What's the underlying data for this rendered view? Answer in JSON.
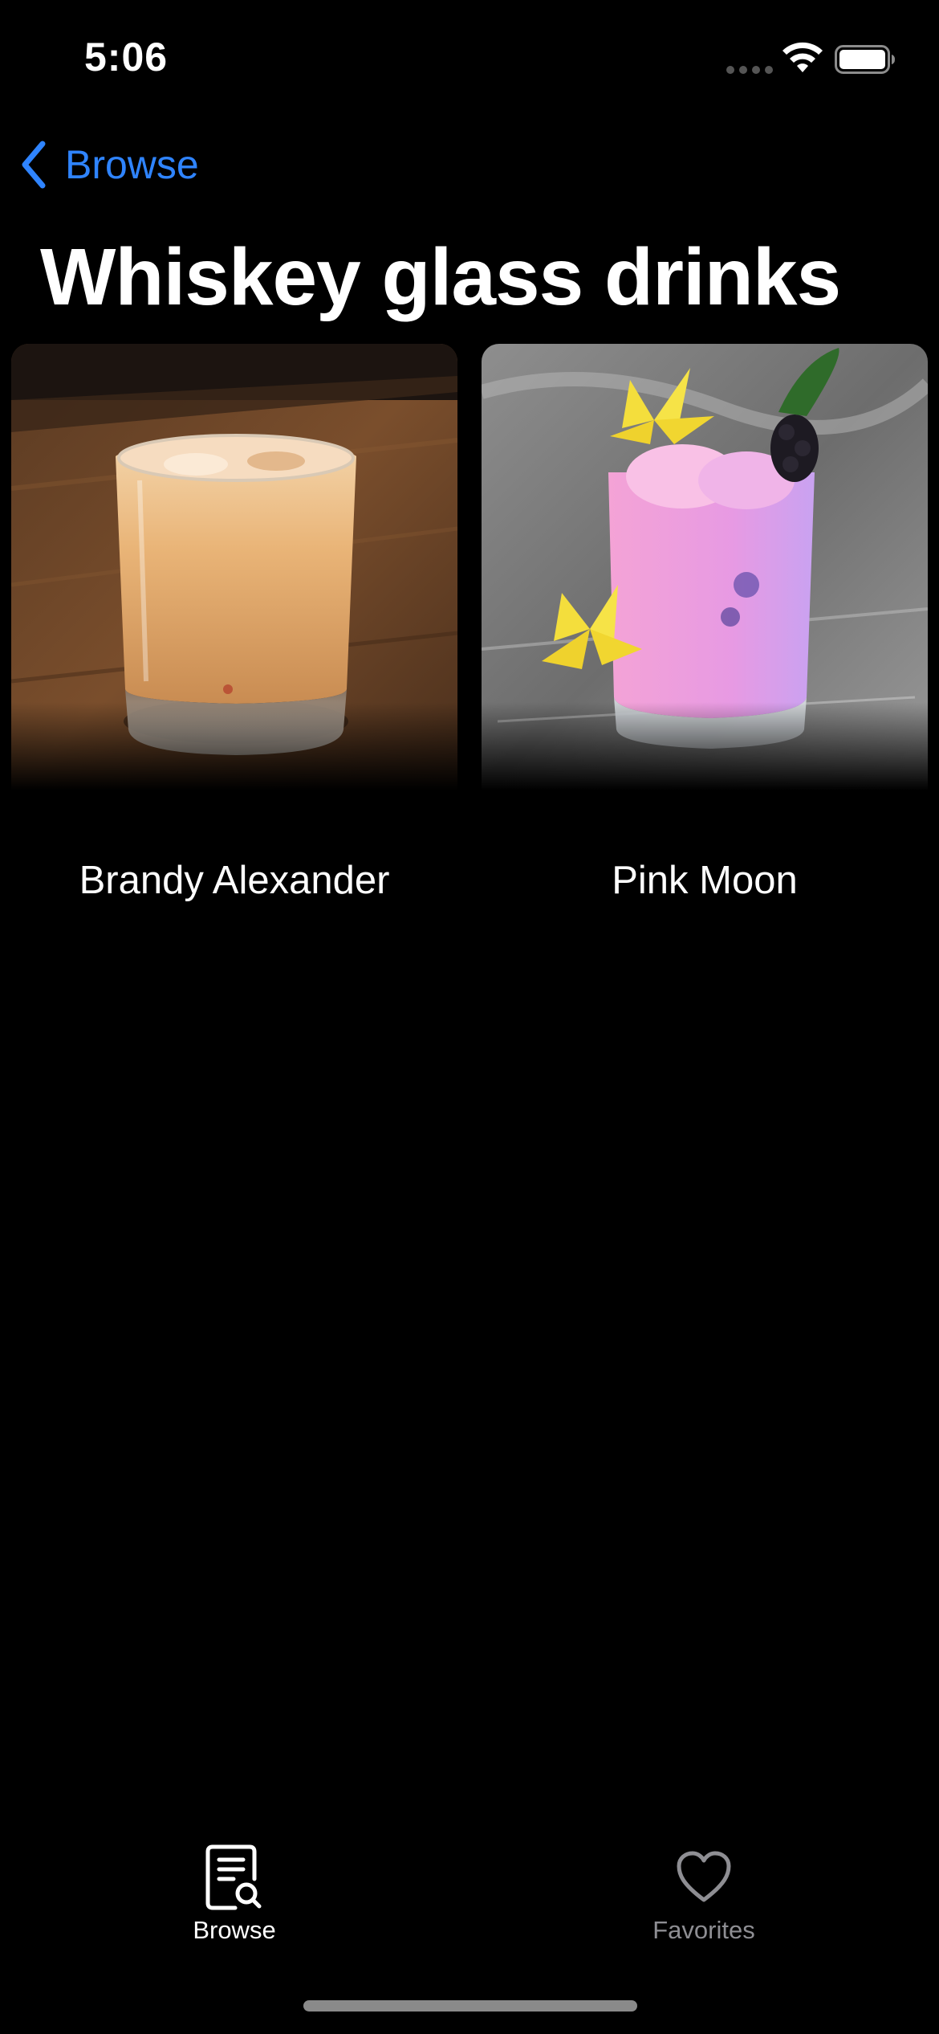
{
  "status_bar": {
    "time": "5:06"
  },
  "navigation": {
    "back_label": "Browse",
    "title": "Whiskey glass drinks"
  },
  "drinks": [
    {
      "name": "Brandy Alexander"
    },
    {
      "name": "Pink Moon"
    }
  ],
  "tab_bar": {
    "items": [
      {
        "label": "Browse",
        "icon": "browse-search-icon",
        "selected": true
      },
      {
        "label": "Favorites",
        "icon": "heart-icon",
        "selected": false
      }
    ]
  },
  "colors": {
    "background": "#000000",
    "accent": "#2f84ff",
    "inactive_tab": "#8e8e93"
  }
}
